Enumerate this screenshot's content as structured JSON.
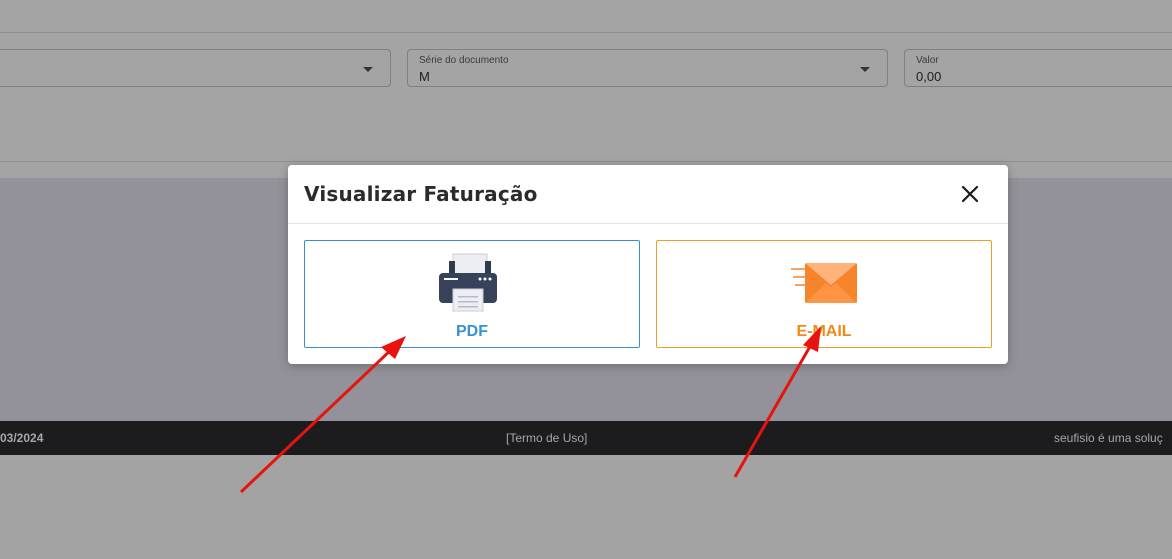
{
  "form": {
    "field1": {
      "label": "",
      "value": ""
    },
    "serie": {
      "label": "Série do documento",
      "value": "M"
    },
    "valor": {
      "label": "Valor",
      "value": "0,00"
    }
  },
  "footer": {
    "left": "03/2024",
    "center": "[Termo de Uso]",
    "right": "seufisio é uma soluç"
  },
  "modal": {
    "title": "Visualizar Faturação",
    "close_icon": "close-icon",
    "options": [
      {
        "label": "PDF",
        "icon": "printer-icon",
        "color": "#3592d4"
      },
      {
        "label": "E-MAIL",
        "icon": "envelope-icon",
        "color": "#f08a16"
      }
    ]
  },
  "annotation_color": "#e8130e"
}
